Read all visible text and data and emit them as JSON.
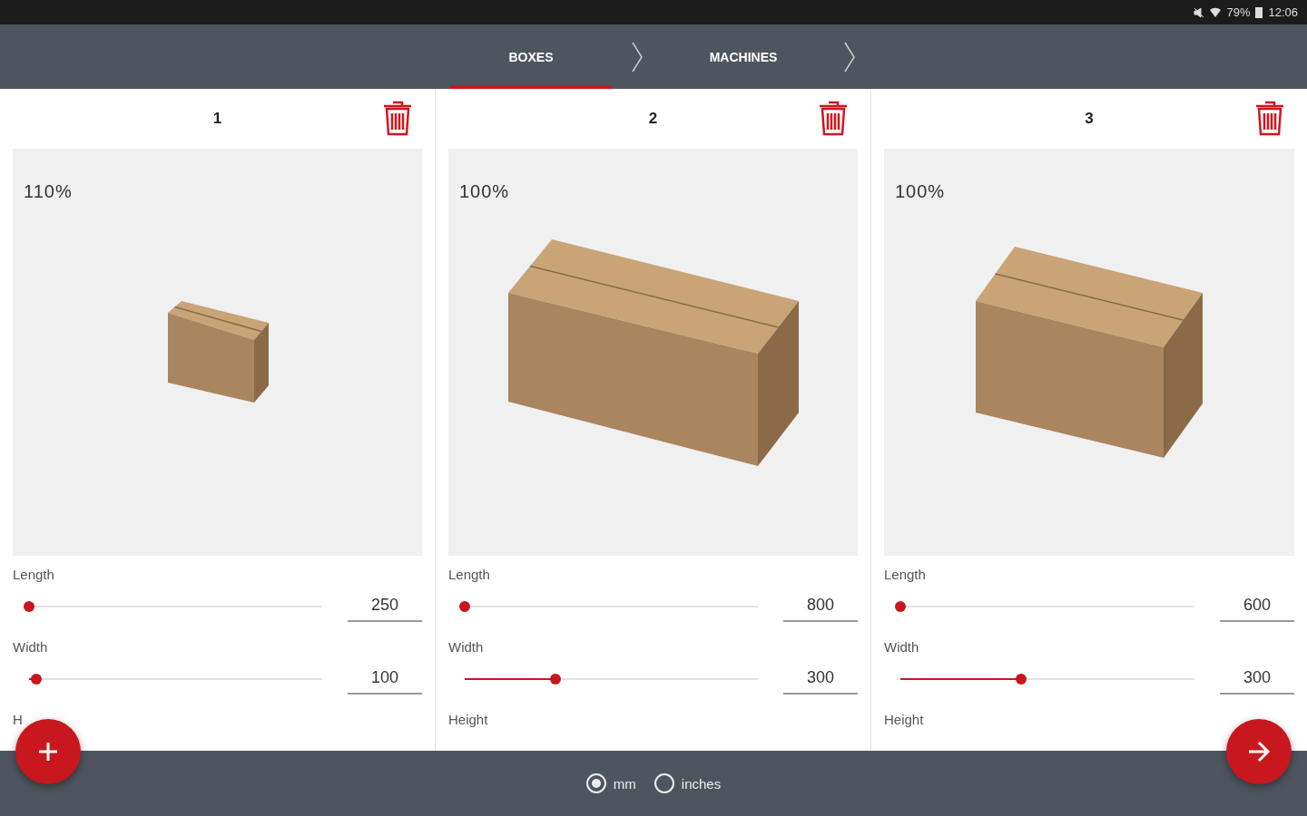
{
  "status_bar": {
    "battery": "79%",
    "time": "12:06"
  },
  "steps": [
    {
      "label": "BOXES",
      "selected": true
    },
    {
      "label": "MACHINES",
      "selected": false
    }
  ],
  "boxes": [
    {
      "number": "1",
      "scale": "110%",
      "kind": "small",
      "sliders": [
        {
          "label": "Length",
          "level": 0.0,
          "value": "250"
        },
        {
          "label": "Width",
          "level": 0.025,
          "value": "100"
        }
      ],
      "next_label": "H"
    },
    {
      "number": "2",
      "scale": "100%",
      "kind": "long",
      "sliders": [
        {
          "label": "Length",
          "level": 0.0,
          "value": "800"
        },
        {
          "label": "Width",
          "level": 0.31,
          "value": "300"
        }
      ],
      "next_label": "Height"
    },
    {
      "number": "3",
      "scale": "100%",
      "kind": "medium",
      "sliders": [
        {
          "label": "Length",
          "level": 0.0,
          "value": "600"
        },
        {
          "label": "Width",
          "level": 0.41,
          "value": "300"
        }
      ],
      "next_label": "Height"
    }
  ],
  "units": [
    {
      "label": "mm",
      "selected": true
    },
    {
      "label": "inches",
      "selected": false
    }
  ]
}
